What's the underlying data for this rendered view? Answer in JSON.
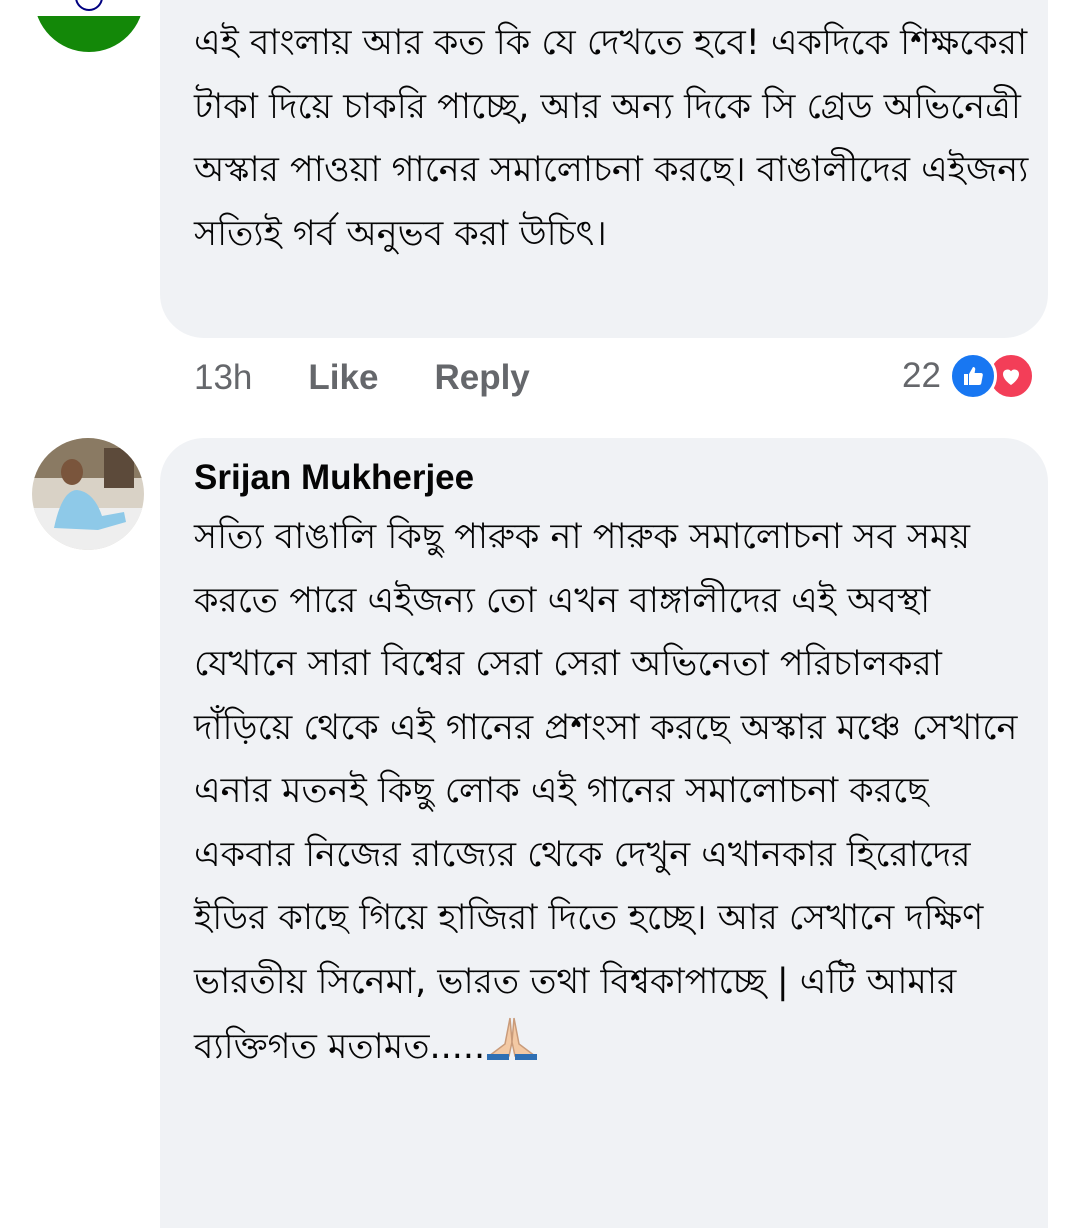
{
  "comments": [
    {
      "author": "",
      "avatar": "india-flag-avatar",
      "text": "এই বাংলায় আর কত কি যে দেখতে হবে! একদিকে শিক্ষকেরা টাকা দিয়ে চাকরি পাচ্ছে, আর অন্য দিকে সি গ্রেড অভিনেত্রী অস্কার পাওয়া গানের সমালোচনা করছে। বাঙালীদের এইজন্য সত্যিই গর্ব অনুভব করা উচিৎ।",
      "time": "13h",
      "like_label": "Like",
      "reply_label": "Reply",
      "reaction_count": "22",
      "reactions": [
        "like-icon",
        "love-icon"
      ],
      "colors": {
        "like": "#1877f2",
        "love": "#f33e58"
      }
    },
    {
      "author": "Srijan Mukherjee",
      "avatar": "photo-avatar",
      "text": "সত্যি বাঙালি কিছু পারুক না পারুক সমালোচনা সব সময় করতে পারে এইজন্য তো এখন বাঙ্গালীদের এই অবস্থা যেখানে সারা বিশ্বের সেরা সেরা অভিনেতা পরিচালকরা দাঁড়িয়ে থেকে এই গানের প্রশংসা করছে অস্কার মঞ্চে সেখানে এনার মতনই কিছু লোক এই গানের সমালোচনা করছে একবার নিজের রাজ্যের থেকে দেখুন এখানকার হিরোদের ইডির কাছে গিয়ে হাজিরা দিতে হচ্ছে। আর সেখানে দক্ষিণ ভারতীয় সিনেমা, ভারত তথা বিশ্বকাপাচ্ছে | এটি আমার ব্যক্তিগত মতামত.....",
      "emoji": "folded-hands-icon"
    }
  ],
  "colors": {
    "bubble": "#f0f2f5",
    "meta_text": "#65676b"
  }
}
